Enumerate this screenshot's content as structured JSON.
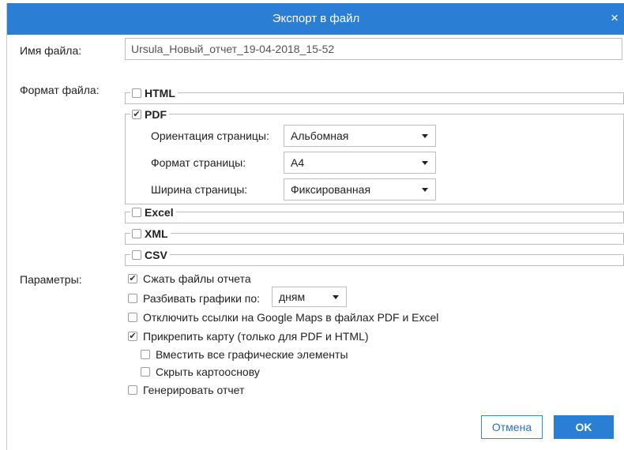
{
  "dialog": {
    "title": "Экспорт в файл",
    "close_glyph": "×"
  },
  "filename": {
    "label": "Имя файла:",
    "value": "Ursula_Новый_отчет_19-04-2018_15-52"
  },
  "format": {
    "label": "Формат файла:",
    "html": {
      "label": "HTML",
      "checked": false
    },
    "pdf": {
      "label": "PDF",
      "checked": true,
      "orientation_label": "Ориентация страницы:",
      "orientation_value": "Альбомная",
      "size_label": "Формат страницы:",
      "size_value": "A4",
      "width_label": "Ширина страницы:",
      "width_value": "Фиксированная"
    },
    "excel": {
      "label": "Excel",
      "checked": false
    },
    "xml": {
      "label": "XML",
      "checked": false
    },
    "csv": {
      "label": "CSV",
      "checked": false
    }
  },
  "params": {
    "label": "Параметры:",
    "compress": {
      "label": "Сжать файлы отчета",
      "checked": true
    },
    "split": {
      "label": "Разбивать графики по:",
      "checked": false,
      "select_value": "дням"
    },
    "disable_links": {
      "label": "Отключить ссылки на Google Maps в файлах PDF и Excel",
      "checked": false
    },
    "attach_map": {
      "label": "Прикрепить карту (только для PDF и HTML)",
      "checked": true
    },
    "fit_all": {
      "label": "Вместить все графические элементы",
      "checked": false
    },
    "hide_base": {
      "label": "Скрыть картооснову",
      "checked": false
    },
    "generate": {
      "label": "Генерировать отчет",
      "checked": false
    }
  },
  "buttons": {
    "cancel": "Отмена",
    "ok": "OK"
  },
  "colors": {
    "accent": "#2a7fd4",
    "border": "#bdbdbd"
  }
}
